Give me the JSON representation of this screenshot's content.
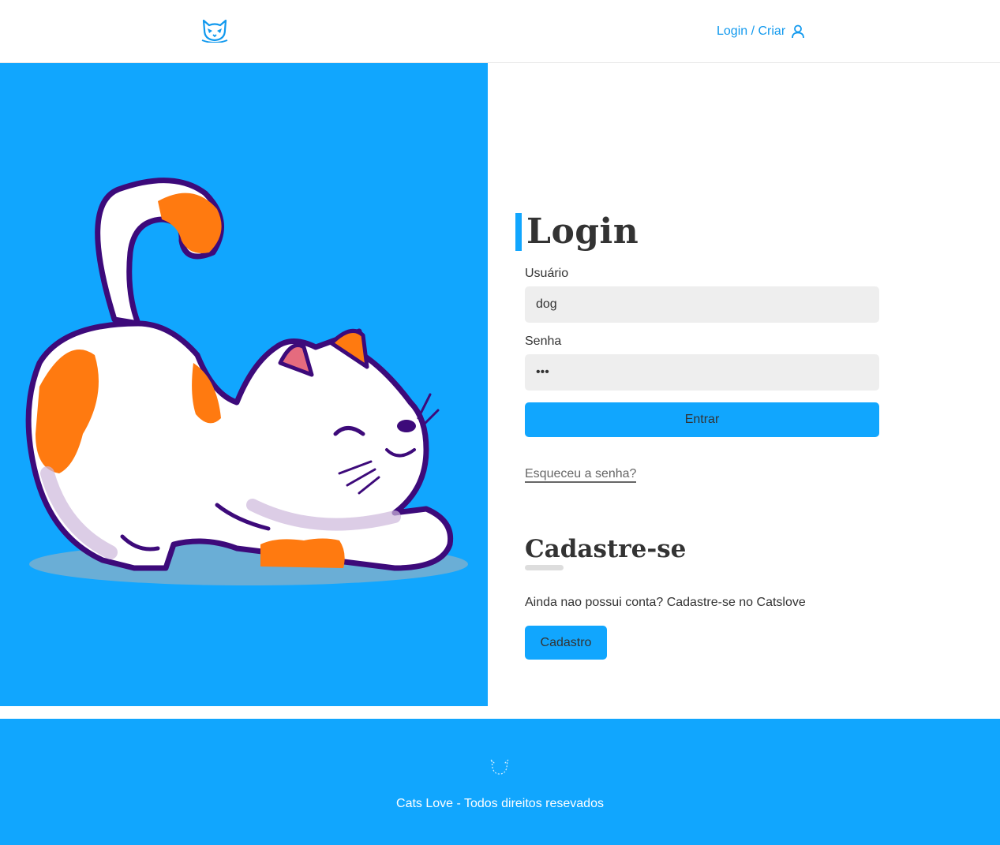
{
  "header": {
    "logo_icon": "cat-face-logo-icon",
    "login_label": "Login / Criar",
    "user_icon": "user-icon"
  },
  "hero": {
    "background_color": "#11a6fe",
    "illustration": "stretching-cat-illustration"
  },
  "login_form": {
    "title": "Login",
    "username_label": "Usuário",
    "username_value": "dog",
    "password_label": "Senha",
    "password_value": "•••",
    "submit_label": "Entrar",
    "forgot_link": "Esqueceu a senha?"
  },
  "register": {
    "title": "Cadastre-se",
    "text": "Ainda nao possui conta? Cadastre-se no Catslove",
    "button_label": "Cadastro"
  },
  "footer": {
    "logo_icon": "cat-outline-logo-icon",
    "text": "Cats Love - Todos direitos resevados"
  },
  "colors": {
    "accent": "#11a6fe",
    "link": "#1199ee",
    "input_bg": "#eeeeee",
    "text": "#333333"
  }
}
